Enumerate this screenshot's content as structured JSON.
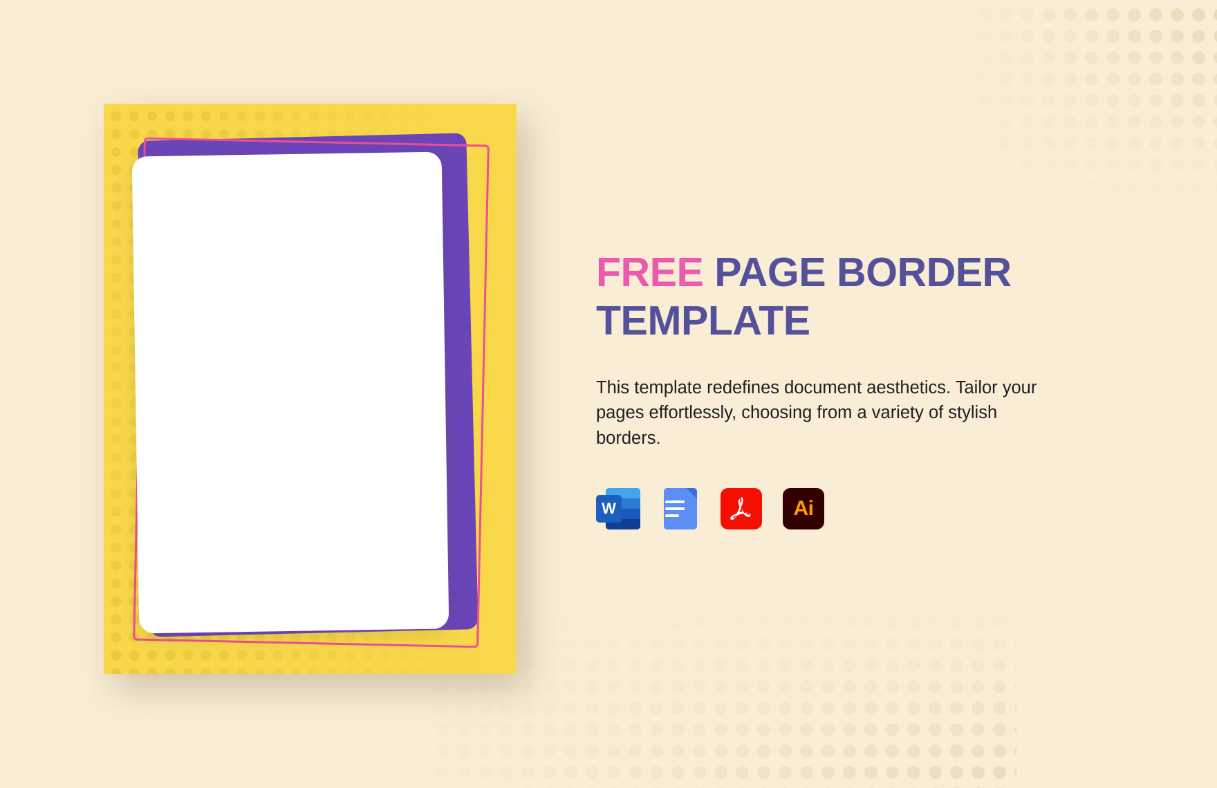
{
  "page": {
    "background_color": "#F9EDD6",
    "accent_pink": "#EA5AAE",
    "accent_purple": "#54519B",
    "artwork_yellow": "#F8D84A",
    "artwork_purple": "#6A45B8",
    "artwork_pink_outline": "#ED4E95",
    "artwork_page_white": "#FFFFFF"
  },
  "hero": {
    "title_highlight": "FREE",
    "title_rest": "PAGE BORDER TEMPLATE",
    "description": "This template redefines document aesthetics. Tailor your pages effortlessly, choosing from a variety of stylish borders."
  },
  "formats": [
    {
      "id": "word",
      "name": "microsoft-word-icon",
      "label": "W",
      "color": "#185ABD"
    },
    {
      "id": "google-docs",
      "name": "google-docs-icon",
      "label": "",
      "color": "#5C8EF5"
    },
    {
      "id": "pdf",
      "name": "pdf-icon",
      "label": "",
      "color": "#F40F02"
    },
    {
      "id": "illustrator",
      "name": "adobe-illustrator-icon",
      "label": "Ai",
      "color": "#330000"
    }
  ],
  "artwork": {
    "name": "page-border-preview",
    "layers": [
      "yellow-backdrop",
      "purple-card",
      "pink-outline-card",
      "white-page"
    ]
  }
}
